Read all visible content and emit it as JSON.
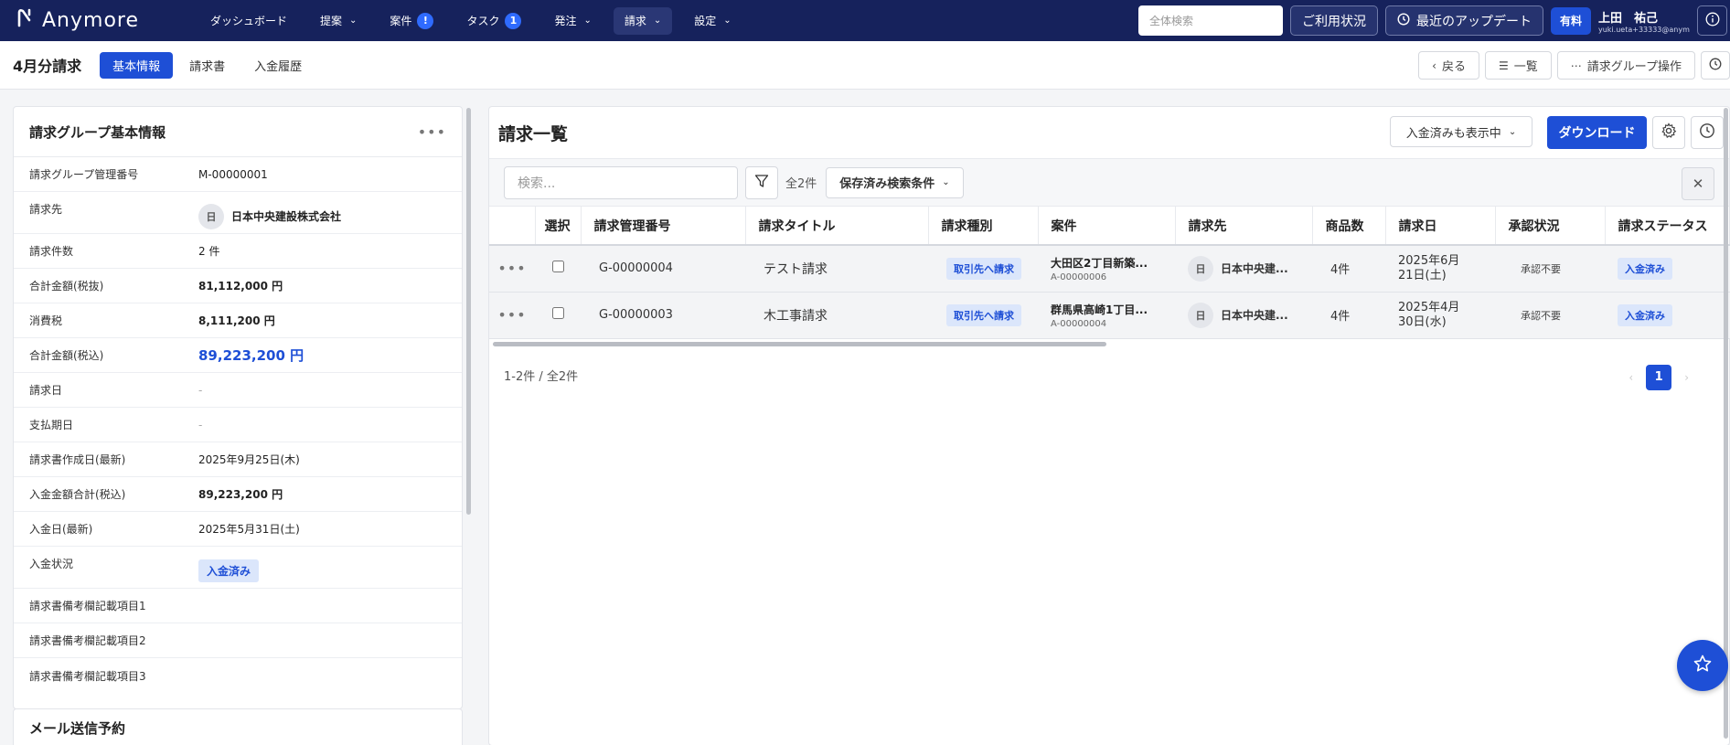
{
  "brand": {
    "name": "Anymore"
  },
  "nav": {
    "items": [
      {
        "label": "ダッシュボード",
        "chevron": false,
        "badge": ""
      },
      {
        "label": "提案",
        "chevron": true,
        "badge": ""
      },
      {
        "label": "案件",
        "chevron": false,
        "badge": "!"
      },
      {
        "label": "タスク",
        "chevron": false,
        "badge": "1"
      },
      {
        "label": "発注",
        "chevron": true,
        "badge": ""
      },
      {
        "label": "請求",
        "chevron": true,
        "badge": "",
        "active": true
      },
      {
        "label": "設定",
        "chevron": true,
        "badge": ""
      }
    ],
    "search_placeholder": "全体検索",
    "usage_label": "ご利用状況",
    "updates_label": "最近のアップデート",
    "plan_label": "有料",
    "user_name": "上田　祐己",
    "user_email": "yuki.ueta+33333@anym..."
  },
  "subheader": {
    "title": "4月分請求",
    "tabs": [
      {
        "label": "基本情報",
        "active": true
      },
      {
        "label": "請求書",
        "active": false
      },
      {
        "label": "入金履歴",
        "active": false
      }
    ],
    "back_label": "戻る",
    "list_label": "一覧",
    "group_ops_label": "請求グループ操作"
  },
  "group_info": {
    "title": "請求グループ基本情報",
    "fields": [
      {
        "label": "請求グループ管理番号",
        "value": "M-00000001",
        "style": ""
      },
      {
        "label": "請求先",
        "value": "日本中央建設株式会社",
        "style": "client",
        "avatar": "日"
      },
      {
        "label": "請求件数",
        "value": "2 件",
        "style": ""
      },
      {
        "label": "合計金額(税抜)",
        "value": "81,112,000 円",
        "style": "bold"
      },
      {
        "label": "消費税",
        "value": "8,111,200 円",
        "style": "bold"
      },
      {
        "label": "合計金額(税込)",
        "value": "89,223,200 円",
        "style": "blue"
      },
      {
        "label": "請求日",
        "value": "-",
        "style": "muted"
      },
      {
        "label": "支払期日",
        "value": "-",
        "style": "muted"
      },
      {
        "label": "請求書作成日(最新)",
        "value": "2025年9月25日(木)",
        "style": ""
      },
      {
        "label": "入金金額合計(税込)",
        "value": "89,223,200 円",
        "style": "bold"
      },
      {
        "label": "入金日(最新)",
        "value": "2025年5月31日(土)",
        "style": ""
      },
      {
        "label": "入金状況",
        "value": "入金済み",
        "style": "pill"
      },
      {
        "label": "請求書備考欄記載項目1",
        "value": "",
        "style": ""
      },
      {
        "label": "請求書備考欄記載項目2",
        "value": "",
        "style": ""
      },
      {
        "label": "請求書備考欄記載項目3",
        "value": "",
        "style": ""
      }
    ],
    "mail_title": "メール送信予約"
  },
  "invoice_list": {
    "title": "請求一覧",
    "paid_filter_label": "入金済みも表示中",
    "download_label": "ダウンロード",
    "search_placeholder": "検索...",
    "count_label": "全2件",
    "saved_search_label": "保存済み検索条件",
    "columns": [
      "",
      "選択",
      "請求管理番号",
      "請求タイトル",
      "請求種別",
      "案件",
      "請求先",
      "商品数",
      "請求日",
      "承認状況",
      "請求ステータス"
    ],
    "rows": [
      {
        "id": "G-00000004",
        "title": "テスト請求",
        "type": "取引先へ請求",
        "project_name": "大田区2丁目新築...",
        "project_code": "A-00000006",
        "client_avatar": "日",
        "client": "日本中央建...",
        "items": "4件",
        "date_line1": "2025年6月",
        "date_line2": "21日(土)",
        "approval": "承認不要",
        "status": "入金済み"
      },
      {
        "id": "G-00000003",
        "title": "木工事請求",
        "type": "取引先へ請求",
        "project_name": "群馬県高崎1丁目...",
        "project_code": "A-00000004",
        "client_avatar": "日",
        "client": "日本中央建...",
        "items": "4件",
        "date_line1": "2025年4月",
        "date_line2": "30日(水)",
        "approval": "承認不要",
        "status": "入金済み"
      }
    ],
    "pagination_summary": "1-2件 / 全2件",
    "current_page": "1"
  },
  "colors": {
    "navy": "#16225c",
    "accent": "#1e4fd6",
    "tag_bg": "#dbe6fb"
  }
}
